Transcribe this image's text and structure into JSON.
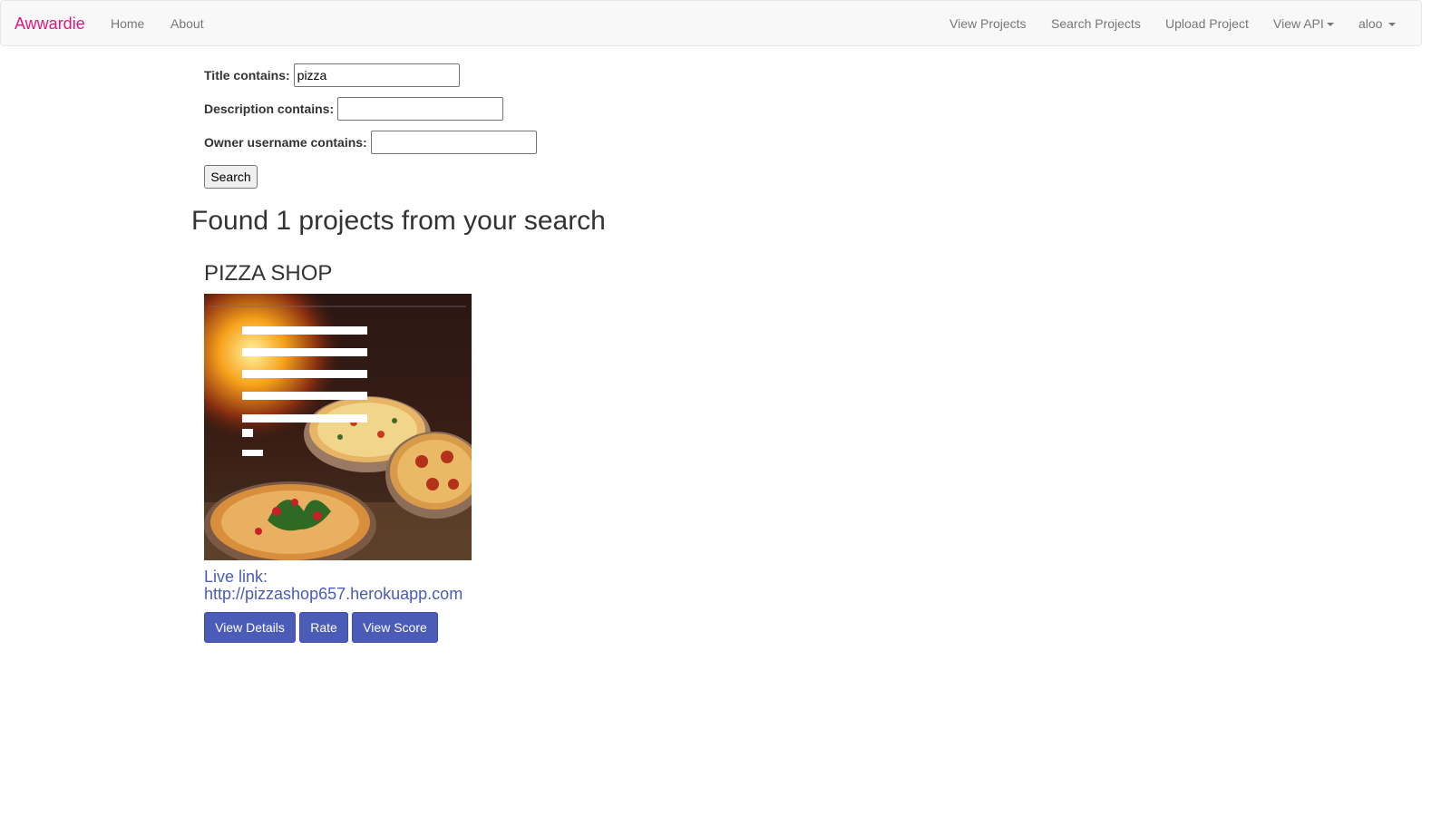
{
  "colors": {
    "brand": "#e0187f",
    "link": "#4a5bb8",
    "button": "#4a5bb8",
    "navbar_bg": "#f8f8f8"
  },
  "navbar": {
    "brand": "Awwardie",
    "left_links": [
      "Home",
      "About"
    ],
    "right_links": [
      "View Projects",
      "Search Projects",
      "Upload Project",
      "View API",
      "aloo"
    ]
  },
  "search_form": {
    "title_label": "Title contains:",
    "title_value": "pizza",
    "description_label": "Description contains:",
    "description_value": "",
    "owner_label": "Owner username contains:",
    "owner_value": "",
    "submit_label": "Search"
  },
  "results": {
    "heading": "Found 1 projects from your search",
    "projects": [
      {
        "title": "PIZZA SHOP",
        "image_icon": "pizza-shop-screenshot",
        "live_link_label": "Live link:",
        "live_link_url": "http://pizzashop657.herokuapp.com",
        "buttons": [
          "View Details",
          "Rate",
          "View Score"
        ]
      }
    ]
  }
}
